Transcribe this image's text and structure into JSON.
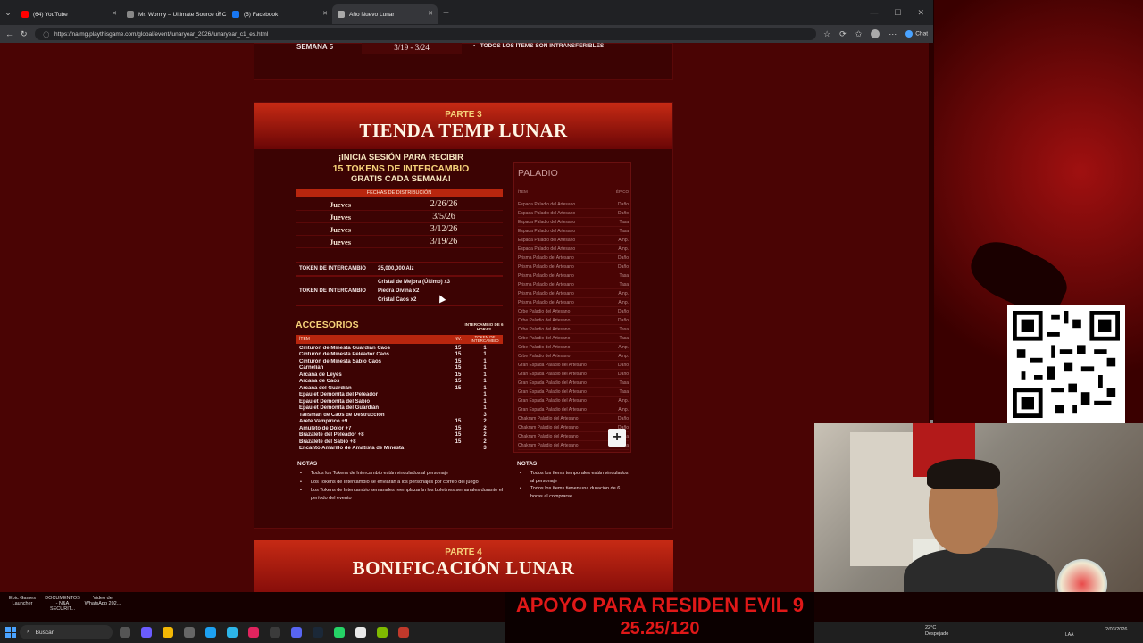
{
  "browser": {
    "tabs": [
      {
        "label": "(64) YouTube",
        "color": "#ff0000",
        "active": false
      },
      {
        "label": "Mr. Wormy – Ultimate Source of C",
        "color": "#888888",
        "active": false
      },
      {
        "label": "(5) Facebook",
        "color": "#1877f2",
        "active": false
      },
      {
        "label": "Año Nuevo Lunar",
        "color": "#aaaaaa",
        "active": true
      }
    ],
    "url": "https://naimg.playthisgame.com/global/event/lunaryear_2026/lunaryear_c1_es.html",
    "chat_label": "Chat"
  },
  "schedule": {
    "week_label": "SEMANA 5",
    "week_dates": "3/19  -  3/24",
    "note": "TODOS LOS ÍTEMS SON INTRANSFERIBLES"
  },
  "part3": {
    "part_label": "PARTE 3",
    "title": "TIENDA TEMP LUNAR",
    "promo_line1": "¡INICIA SESIÓN PARA RECIBIR",
    "promo_line2": "15 TOKENS DE INTERCAMBIO",
    "promo_line3": "GRATIS CADA SEMANA!",
    "dist_header": "FECHAS DE DISTRIBUCIÓN",
    "dist_rows": [
      {
        "day": "Jueves",
        "date": "2/26/26"
      },
      {
        "day": "Jueves",
        "date": "3/5/26"
      },
      {
        "day": "Jueves",
        "date": "3/12/26"
      },
      {
        "day": "Jueves",
        "date": "3/19/26"
      }
    ],
    "token_rows": [
      {
        "label": "TOKEN DE INTERCAMBIO",
        "values": [
          "25,000,000 Alz"
        ]
      },
      {
        "label": "TOKEN DE INTERCAMBIO",
        "values": [
          "Cristal de Mejora (Último) x3",
          "Piedra Divina x2",
          "Cristal Caos x2"
        ]
      }
    ],
    "accessories": {
      "title": "ACCESORIOS",
      "exchange_note": "INTERCAMBIO DE 6 HORAS",
      "col_item": "ÍTEM",
      "col_level": "NV.",
      "col_token": "TOKEN DE INTERCAMBIO",
      "rows": [
        {
          "name": "Cinturón de Minesta Guardián Caos",
          "level": "15",
          "token": "1"
        },
        {
          "name": "Cinturón de Minesta Peleador Caos",
          "level": "15",
          "token": "1"
        },
        {
          "name": "Cinturón de Minesta Sabio Caos",
          "level": "15",
          "token": "1"
        },
        {
          "name": "Carnelian",
          "level": "15",
          "token": "1"
        },
        {
          "name": "Arcana de Leyes",
          "level": "15",
          "token": "1"
        },
        {
          "name": "Arcana de Caos",
          "level": "15",
          "token": "1"
        },
        {
          "name": "Arcana del Guardián",
          "level": "15",
          "token": "1"
        },
        {
          "name": "Epaulet Demonita del Peleador",
          "level": "",
          "token": "1"
        },
        {
          "name": "Epaulet Demonita del Sabio",
          "level": "",
          "token": "1"
        },
        {
          "name": "Epaulet Demonita del Guardián",
          "level": "",
          "token": "1"
        },
        {
          "name": "Talismán de Caos de Destrucción",
          "level": "",
          "token": "3"
        },
        {
          "name": "Arete Vampírico +9",
          "level": "15",
          "token": "2"
        },
        {
          "name": "Amuleto de Dolor +7",
          "level": "15",
          "token": "2"
        },
        {
          "name": "Brazalete del Peleador +8",
          "level": "15",
          "token": "2"
        },
        {
          "name": "Brazalete del Sabio +8",
          "level": "15",
          "token": "2"
        },
        {
          "name": "Encanto Amarillo de Amatista de Minesta",
          "level": "",
          "token": "3"
        }
      ]
    },
    "notes_left_title": "NOTAS",
    "notes_left": [
      "Todos los Tokens de Intercambio están vinculados al personaje",
      "Los Tokens de Intercambio se enviarán a los personajes por correo del juego",
      "Los Tokens de Intercambio semanales reemplazarán los boletines semanales durante el período del evento"
    ],
    "notes_right_title": "NOTAS",
    "notes_right": [
      "Todos los ítems temporales están vinculados al personaje",
      "Todos los ítems tienen una duración de 6 horas al comprarse"
    ],
    "paladio": {
      "title": "PALADIO",
      "col_item": "ÍTEM",
      "col_epic": "ÉPICO",
      "rows": [
        {
          "name": "Espada Paladio del Artesano",
          "epic": "Daño"
        },
        {
          "name": "Espada Paladio del Artesano",
          "epic": "Daño"
        },
        {
          "name": "Espada Paladio del Artesano",
          "epic": "Tasa"
        },
        {
          "name": "Espada Paladio del Artesano",
          "epic": "Tasa"
        },
        {
          "name": "Espada Paladio del Artesano",
          "epic": "Amp."
        },
        {
          "name": "Espada Paladio del Artesano",
          "epic": "Amp."
        },
        {
          "name": "Prisma Paladio del Artesano",
          "epic": "Daño"
        },
        {
          "name": "Prisma Paladio del Artesano",
          "epic": "Daño"
        },
        {
          "name": "Prisma Paladio del Artesano",
          "epic": "Tasa"
        },
        {
          "name": "Prisma Paladio del Artesano",
          "epic": "Tasa"
        },
        {
          "name": "Prisma Paladio del Artesano",
          "epic": "Amp."
        },
        {
          "name": "Prisma Paladio del Artesano",
          "epic": "Amp."
        },
        {
          "name": "Orbe Paladio del Artesano",
          "epic": "Daño"
        },
        {
          "name": "Orbe Paladio del Artesano",
          "epic": "Daño"
        },
        {
          "name": "Orbe Paladio del Artesano",
          "epic": "Tasa"
        },
        {
          "name": "Orbe Paladio del Artesano",
          "epic": "Tasa"
        },
        {
          "name": "Orbe Paladio del Artesano",
          "epic": "Amp."
        },
        {
          "name": "Orbe Paladio del Artesano",
          "epic": "Amp."
        },
        {
          "name": "Gran Espada Paladio del Artesano",
          "epic": "Daño"
        },
        {
          "name": "Gran Espada Paladio del Artesano",
          "epic": "Daño"
        },
        {
          "name": "Gran Espada Paladio del Artesano",
          "epic": "Tasa"
        },
        {
          "name": "Gran Espada Paladio del Artesano",
          "epic": "Tasa"
        },
        {
          "name": "Gran Espada Paladio del Artesano",
          "epic": "Amp."
        },
        {
          "name": "Gran Espada Paladio del Artesano",
          "epic": "Amp."
        },
        {
          "name": "Chakram Paladio del Artesano",
          "epic": "Daño"
        },
        {
          "name": "Chakram Paladio del Artesano",
          "epic": "Daño"
        },
        {
          "name": "Chakram Paladio del Artesano",
          "epic": "Tasa"
        },
        {
          "name": "Chakram Paladio del Artesano",
          "epic": "Tasa"
        }
      ]
    }
  },
  "part4": {
    "part_label": "PARTE 4",
    "title": "BONIFICACIÓN LUNAR"
  },
  "desktop_icons": [
    {
      "label": "Epic Games Launcher"
    },
    {
      "label": "DOCUMENTOS - N&A SECURIT..."
    },
    {
      "label": "Video de WhatsApp 202..."
    }
  ],
  "banner": {
    "line1": "APOYO PARA RESIDEN EVIL 9",
    "line2": "25.25/120"
  },
  "taskbar": {
    "search_placeholder": "Buscar",
    "weather_temp": "22°C",
    "weather_text": "Despejado",
    "lang": "LAA",
    "date": "2/03/2026"
  },
  "colors": {
    "page_bg": "#4a0404",
    "header_red": "#c62a14",
    "gold": "#f6d27a",
    "banner_red": "#e01818"
  }
}
